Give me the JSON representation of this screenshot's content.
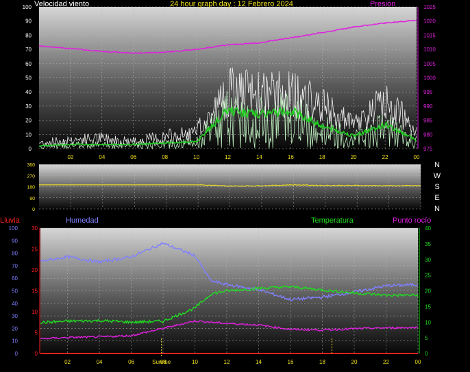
{
  "title": "24 hour graph day : 12 Febrero 2024",
  "colors": {
    "background": "#000000",
    "title": "#f0e020",
    "wind_label": "#ffffff",
    "pressure": "#e020e0",
    "gust": "#f0f0f0",
    "avg_wind": "#22cc22",
    "speed_light": "#c0f0c0",
    "direction": "#f0e020",
    "rain": "#ff2020",
    "humidity": "#8080ff",
    "temperature": "#20dd20",
    "dewpoint": "#e020e0",
    "sun": "#f0e020",
    "axis_text": "#ffffff"
  },
  "x_tick_labels": [
    "02",
    "04",
    "06",
    "08",
    "10",
    "12",
    "14",
    "16",
    "18",
    "20",
    "22",
    "00"
  ],
  "compass": [
    "N",
    "W",
    "S",
    "E",
    "N"
  ],
  "sunrise_label": "Sunrise",
  "chart_data": [
    {
      "type": "line",
      "panel": "wind",
      "title": "24 hour graph day : 12 Febrero 2024",
      "left_axis_label": "Velocidad viento",
      "right_axis_label": "Presión",
      "x_hours": [
        0,
        2,
        4,
        6,
        8,
        10,
        12,
        14,
        16,
        18,
        20,
        22,
        24
      ],
      "ylim_left": [
        0,
        100
      ],
      "yticks_left": [
        "0",
        "10",
        "20",
        "30",
        "40",
        "50",
        "60",
        "70",
        "80",
        "90",
        "100"
      ],
      "ylim_right": [
        975,
        1025
      ],
      "yticks_right": [
        "975",
        "980",
        "985",
        "990",
        "995",
        "1000",
        "1005",
        "1010",
        "1015",
        "1020",
        "1025"
      ],
      "series": [
        {
          "name": "Presión",
          "axis": "right",
          "values": [
            1011.2,
            1010.3,
            1009.3,
            1008.7,
            1009.0,
            1010.0,
            1011.6,
            1012.3,
            1014.1,
            1015.9,
            1017.9,
            1019.3,
            1020.3
          ]
        },
        {
          "role": "gust",
          "axis": "left",
          "values": [
            4,
            6,
            7,
            5,
            8,
            10,
            40,
            38,
            38,
            30,
            16,
            33,
            15
          ]
        },
        {
          "role": "average",
          "axis": "left",
          "values": [
            2,
            3,
            3,
            3,
            4,
            5,
            27,
            24,
            27,
            16,
            9,
            17,
            6
          ]
        }
      ]
    },
    {
      "type": "line",
      "panel": "direction",
      "x_hours": [
        0,
        2,
        4,
        6,
        8,
        10,
        12,
        14,
        16,
        18,
        20,
        22,
        24
      ],
      "ylim": [
        0,
        360
      ],
      "yticks": [
        "0",
        "90",
        "180",
        "270",
        "360"
      ],
      "series": [
        {
          "role": "direction",
          "values": [
            195,
            195,
            195,
            195,
            195,
            195,
            185,
            188,
            195,
            190,
            190,
            188,
            188
          ]
        }
      ]
    },
    {
      "type": "line",
      "panel": "climate",
      "left_label_rain": "Lluvia",
      "left_label_humidity": "Humedad",
      "right_label_temperature": "Temperatura",
      "right_label_dewpoint": "Punto rocío",
      "x_hours": [
        0,
        2,
        4,
        6,
        8,
        10,
        11,
        12,
        14,
        16,
        18,
        20,
        22,
        24
      ],
      "ylim_humidity": [
        0,
        100
      ],
      "yticks_humidity": [
        "0",
        "10",
        "20",
        "30",
        "40",
        "50",
        "60",
        "70",
        "80",
        "90",
        "100"
      ],
      "ylim_rain": [
        0,
        30
      ],
      "yticks_rain": [
        "0",
        "5",
        "10",
        "15",
        "20",
        "25",
        "30"
      ],
      "ylim_temp": [
        0,
        40
      ],
      "yticks_temp": [
        "0",
        "5",
        "10",
        "15",
        "20",
        "25",
        "30",
        "35",
        "40"
      ],
      "sunrise_hour": 7.9,
      "sunset_hour": 18.6,
      "series": [
        {
          "name": "Humedad",
          "axis": "humidity",
          "values": [
            73,
            77,
            73,
            77,
            88,
            78,
            58,
            55,
            51,
            43,
            45,
            49,
            54,
            55
          ]
        },
        {
          "name": "Temperatura",
          "axis": "temp",
          "values": [
            9.8,
            10.3,
            10.5,
            10.0,
            10.3,
            14.5,
            19.0,
            20.0,
            20.8,
            21.3,
            20.3,
            19.3,
            18.6,
            18.6
          ]
        },
        {
          "name": "Punto rocío",
          "axis": "temp",
          "values": [
            4.6,
            5.1,
            5.3,
            5.7,
            8.0,
            10.4,
            10.0,
            9.6,
            9.1,
            7.7,
            7.5,
            7.9,
            8.2,
            8.3
          ]
        },
        {
          "name": "Lluvia",
          "axis": "rain",
          "values": [
            0,
            0,
            0,
            0,
            0,
            0,
            0,
            0,
            0,
            0,
            0,
            0,
            0,
            0
          ]
        }
      ]
    }
  ]
}
